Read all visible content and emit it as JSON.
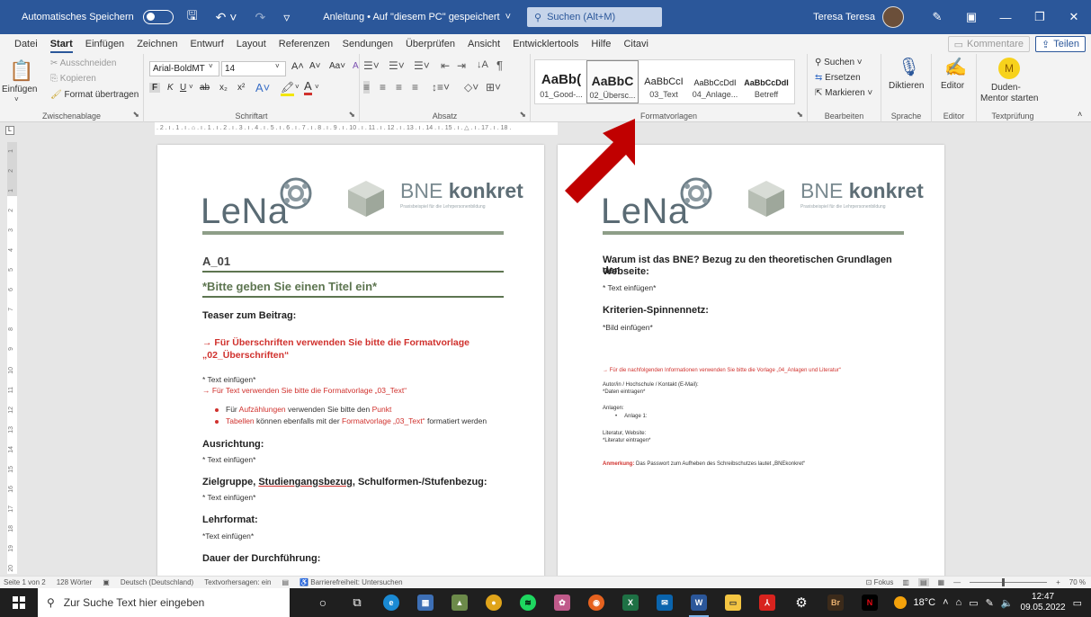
{
  "titlebar": {
    "autosave": "Automatisches Speichern",
    "doc": "Anleitung • Auf \"diesem PC\" gespeichert",
    "search": "Suchen (Alt+M)",
    "user": "Teresa Teresa"
  },
  "tabs": [
    "Datei",
    "Start",
    "Einfügen",
    "Zeichnen",
    "Entwurf",
    "Layout",
    "Referenzen",
    "Sendungen",
    "Überprüfen",
    "Ansicht",
    "Entwicklertools",
    "Hilfe",
    "Citavi"
  ],
  "tabs_right": {
    "comments": "Kommentare",
    "share": "Teilen"
  },
  "ribbon": {
    "clipboard": {
      "paste": "Einfügen",
      "cut": "Ausschneiden",
      "copy": "Kopieren",
      "format": "Format übertragen",
      "label": "Zwischenablage"
    },
    "font": {
      "name": "Arial-BoldMT",
      "size": "14",
      "label": "Schriftart",
      "case": "Aa",
      "bold": "F",
      "italic": "K",
      "underline": "U",
      "strike": "ab",
      "sub": "x₂",
      "sup": "x²"
    },
    "paragraph": {
      "label": "Absatz"
    },
    "styles": {
      "label": "Formatvorlagen",
      "items": [
        {
          "preview": "AaBb(",
          "name": "01_Good-..."
        },
        {
          "preview": "AaBbC",
          "name": "02_Übersc..."
        },
        {
          "preview": "AaBbCcI",
          "name": "03_Text"
        },
        {
          "preview": "AaBbCcDdI",
          "name": "04_Anlage..."
        },
        {
          "preview": "AaBbCcDdI",
          "name": "Betreff"
        }
      ]
    },
    "editing": {
      "find": "Suchen",
      "replace": "Ersetzen",
      "select": "Markieren",
      "label": "Bearbeiten"
    },
    "voice": {
      "dictate": "Diktieren",
      "label": "Sprache"
    },
    "editor": {
      "editor": "Editor",
      "label": "Editor"
    },
    "duden": {
      "line1": "Duden-",
      "line2": "Mentor starten",
      "label": "Textprüfung",
      "avatar": "M"
    }
  },
  "ruler": ". 2 . ı . 1 . ı . ⌂ . ı . 1 . ı . 2 . ı . 3 . ı . 4 . ı . 5 . ı . 6 . ı . 7 . ı . 8 . ı . 9 . ı . 10 . ı . 11 . ı . 12 . ı . 13 . ı . 14 . ı . 15 . ı . △ . ı . 17 . ı . 18 .",
  "ruler_left": [
    "1",
    "2",
    "1",
    "2",
    "3",
    "4",
    "5",
    "6",
    "7",
    "8",
    "9",
    "10",
    "11",
    "12",
    "13",
    "14",
    "15",
    "16",
    "17",
    "18",
    "19",
    "20"
  ],
  "logos": {
    "lena": "LeNa",
    "bne1": "BNE ",
    "bne2": "konkret",
    "bne_sub": "Praxisbeispiel für die Lehrpersonenbildung"
  },
  "page1": {
    "id": "A_01",
    "title": "*Bitte geben Sie einen Titel ein*",
    "teaser": "Teaser zum Beitrag:",
    "hint_line1": "→ Für Überschriften verwenden Sie bitte die Formatvorlage",
    "hint_line2": "„02_Überschriften“",
    "text1": "* Text einfügen*",
    "text_hint": "→ Für Text verwenden Sie bitte die Formatvorlage „03_Text“",
    "b1_a": "Für ",
    "b1_red": "Aufzählungen",
    "b1_b": " verwenden Sie bitte den ",
    "b1_red2": "Punkt",
    "b2_red": "Tabellen",
    "b2_a": " können ebenfalls mit der ",
    "b2_red2": "Formatvorlage „03_Text“",
    "b2_b": " formatiert werden",
    "s_ausrichtung": "Ausrichtung:",
    "t_ausrichtung": "* Text einfügen*",
    "s_zielgruppe_a": "Zielgruppe, ",
    "s_zielgruppe_u": "Studiengangsbezug",
    "s_zielgruppe_b": ", Schulformen-/Stufenbezug:",
    "t_zielgruppe": "* Text einfügen*",
    "s_lehrformat": "Lehrformat:",
    "t_lehrformat": "*Text einfügen*",
    "s_dauer": "Dauer der Durchführung:"
  },
  "page2": {
    "h1_line1": "Warum ist das BNE? Bezug zu den theoretischen Grundlagen der",
    "h1_line2": "Webseite:",
    "t1": "* Text einfügen*",
    "h2": "Kriterien-Spinnennetz:",
    "t2": "*Bild einfügen*",
    "hint": "→ Für die nachfolgenden Informationen verwenden Sie bitte die Vorlage „04_Anlagen und Literatur“",
    "autor": "Autor/in / Hochschule / Kontakt (E-Mail):",
    "daten": "*Daten eintragen*",
    "anlagen": "Anlagen:",
    "anlage1": "Anlage 1:",
    "literatur": "Literatur, Website:",
    "literatur_t": "*Literatur eintragen*",
    "anmerkung_label": "Anmerkung:",
    "anmerkung": " Das Passwort zum Aufheben des Schreibschutzes lautet „BNEkonkret“"
  },
  "status": {
    "page": "Seite 1 von 2",
    "words": "128 Wörter",
    "lang": "Deutsch (Deutschland)",
    "predict": "Textvorhersagen: ein",
    "access": "Barrierefreiheit: Untersuchen",
    "focus": "Fokus",
    "zoom": "70 %"
  },
  "taskbar": {
    "search": "Zur Suche Text hier eingeben",
    "temp": "18°C",
    "time": "12:47",
    "date": "09.05.2022"
  },
  "colors": {
    "word_blue": "#2b579a",
    "red": "#d0312d",
    "green": "#5d7550",
    "arrow": "#c00000"
  }
}
